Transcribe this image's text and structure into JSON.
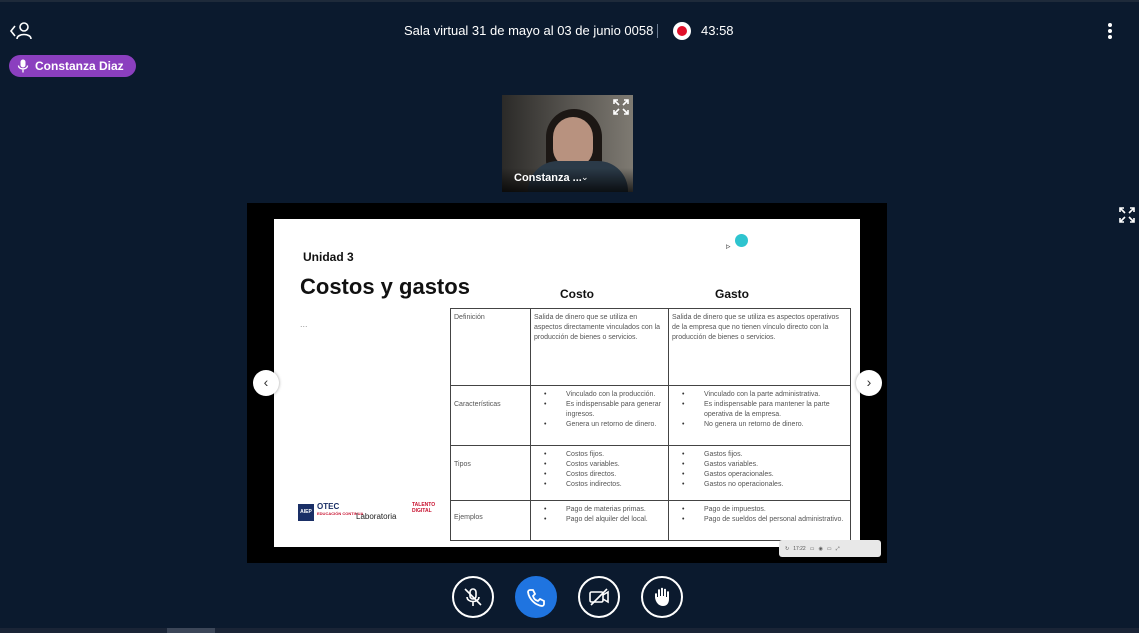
{
  "header": {
    "title": "Sala virtual 31 de mayo al 03 de junio 0058",
    "timer": "43:58",
    "back_icon": "person-back-icon",
    "menu_icon": "kebab-menu-icon",
    "record_color": "#e0102a"
  },
  "speaker": {
    "name": "Constanza Diaz",
    "color": "#8b3fbf"
  },
  "camera": {
    "name": "Constanza ...",
    "chevron": "⌄"
  },
  "slide": {
    "unit": "Unidad 3",
    "title": "Costos y gastos",
    "ellipsis": "...",
    "col_costo": "Costo",
    "col_gasto": "Gasto",
    "rows": [
      {
        "label": "Definición",
        "costo": "Salida de dinero que se utiliza en aspectos directamente vinculados con la producción de bienes o servicios.",
        "gasto": "Salida de dinero que se utiliza es aspectos operativos de la empresa que no tienen vínculo directo con la producción de bienes o servicios."
      },
      {
        "label": "Características",
        "costo": [
          "Vinculado con la producción.",
          "Es indispensable para generar ingresos.",
          "Genera un retorno de dinero."
        ],
        "gasto": [
          "Vinculado con la parte administrativa.",
          "Es indispensable para mantener la parte operativa de la empresa.",
          "No genera un retorno de dinero."
        ]
      },
      {
        "label": "Tipos",
        "costo": [
          "Costos fijos.",
          "Costos variables.",
          "Costos directos.",
          "Costos indirectos."
        ],
        "gasto": [
          "Gastos fijos.",
          "Gastos variables.",
          "Gastos operacionales.",
          "Gastos no operacionales."
        ]
      },
      {
        "label": "Ejemplos",
        "costo": [
          "Pago de materias primas.",
          "Pago del alquiler del local."
        ],
        "gasto": [
          "Pago de impuestos.",
          "Pago de sueldos del personal administrativo."
        ]
      }
    ],
    "logos": {
      "aiep": "AIEP",
      "otec": "OTEC",
      "otec_sub": "EDUCACIÓN CONTINUA",
      "lab": "Laboratoria",
      "talento": "TALENTO DIGITAL"
    }
  },
  "player": {
    "time": "17:22"
  },
  "nav": {
    "prev": "‹",
    "next": "›"
  },
  "controls": {
    "mic_icon": "mic-off-icon",
    "end_icon": "phone-end-icon",
    "camera_icon": "camera-off-icon",
    "hand_icon": "raise-hand-icon",
    "end_color": "#1f74e0"
  }
}
